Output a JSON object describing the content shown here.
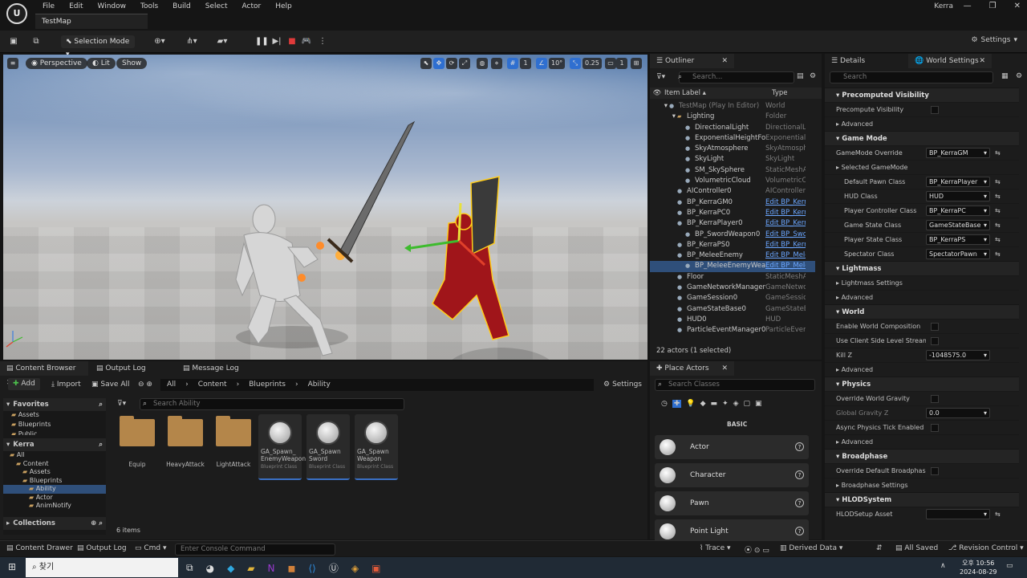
{
  "menu": [
    "File",
    "Edit",
    "Window",
    "Tools",
    "Build",
    "Select",
    "Actor",
    "Help"
  ],
  "project_name": "Kerra",
  "map_tab": "TestMap",
  "toolbar": {
    "selection_mode": "Selection Mode",
    "settings": "Settings"
  },
  "viewport": {
    "perspective": "Perspective",
    "lit": "Lit",
    "show": "Show",
    "grid_size": "1",
    "rot_snap": "10°",
    "scale_snap": "0.25",
    "cam_speed": "1"
  },
  "outliner": {
    "tab": "Outliner",
    "search_placeholder": "Search...",
    "col_label": "Item Label ▴",
    "col_type": "Type",
    "rows": [
      {
        "label": "TestMap (Play In Editor)",
        "type": "World",
        "indent": 0,
        "dim": true
      },
      {
        "label": "Lighting",
        "type": "Folder",
        "indent": 1
      },
      {
        "label": "DirectionalLight",
        "type": "DirectionalLi",
        "indent": 2
      },
      {
        "label": "ExponentialHeightFog",
        "type": "ExponentialH",
        "indent": 2
      },
      {
        "label": "SkyAtmosphere",
        "type": "SkyAtmosph",
        "indent": 2
      },
      {
        "label": "SkyLight",
        "type": "SkyLight",
        "indent": 2
      },
      {
        "label": "SM_SkySphere",
        "type": "StaticMeshA",
        "indent": 2
      },
      {
        "label": "VolumetricCloud",
        "type": "VolumetricClo",
        "indent": 2
      },
      {
        "label": "AIController0",
        "type": "AIController",
        "indent": 1
      },
      {
        "label": "BP_KerraGM0",
        "type": "Edit BP_Kerr",
        "indent": 1,
        "link": true
      },
      {
        "label": "BP_KerraPC0",
        "type": "Edit BP_Kerr",
        "indent": 1,
        "link": true
      },
      {
        "label": "BP_KerraPlayer0",
        "type": "Edit BP_Kerr",
        "indent": 1,
        "link": true
      },
      {
        "label": "BP_SwordWeapon0",
        "type": "Edit BP_Swo",
        "indent": 2,
        "link": true
      },
      {
        "label": "BP_KerraPS0",
        "type": "Edit BP_Kerr",
        "indent": 1,
        "link": true
      },
      {
        "label": "BP_MeleeEnemy",
        "type": "Edit BP_Mele",
        "indent": 1,
        "link": true
      },
      {
        "label": "BP_MeleeEnemyWeapo",
        "type": "Edit BP_Mele",
        "indent": 2,
        "link": true,
        "selected": true
      },
      {
        "label": "Floor",
        "type": "StaticMeshA",
        "indent": 1
      },
      {
        "label": "GameNetworkManager0",
        "type": "GameNetwor",
        "indent": 1
      },
      {
        "label": "GameSession0",
        "type": "GameSessio",
        "indent": 1
      },
      {
        "label": "GameStateBase0",
        "type": "GameStateB",
        "indent": 1
      },
      {
        "label": "HUD0",
        "type": "HUD",
        "indent": 1
      },
      {
        "label": "ParticleEventManager0",
        "type": "ParticleEven",
        "indent": 1
      }
    ],
    "status": "22 actors (1 selected)"
  },
  "details": {
    "tab1": "Details",
    "tab2": "World Settings",
    "search": "Search",
    "sections": [
      {
        "kind": "hdr",
        "text": "Precomputed Visibility"
      },
      {
        "kind": "cb",
        "text": "Precompute Visibility"
      },
      {
        "kind": "sub",
        "text": "Advanced"
      },
      {
        "kind": "hdr",
        "text": "Game Mode"
      },
      {
        "kind": "dd",
        "text": "GameMode Override",
        "value": "BP_KerraGM"
      },
      {
        "kind": "sub",
        "text": "Selected GameMode"
      },
      {
        "kind": "dd2",
        "text": "Default Pawn Class",
        "value": "BP_KerraPlayer"
      },
      {
        "kind": "dd2",
        "text": "HUD Class",
        "value": "HUD"
      },
      {
        "kind": "dd2",
        "text": "Player Controller Class",
        "value": "BP_KerraPC"
      },
      {
        "kind": "dd2",
        "text": "Game State Class",
        "value": "GameStateBase"
      },
      {
        "kind": "dd2",
        "text": "Player State Class",
        "value": "BP_KerraPS"
      },
      {
        "kind": "dd2",
        "text": "Spectator Class",
        "value": "SpectatorPawn"
      },
      {
        "kind": "hdr",
        "text": "Lightmass"
      },
      {
        "kind": "sub",
        "text": "Lightmass Settings"
      },
      {
        "kind": "sub",
        "text": "Advanced"
      },
      {
        "kind": "hdr",
        "text": "World"
      },
      {
        "kind": "cb",
        "text": "Enable World Composition"
      },
      {
        "kind": "cb",
        "text": "Use Client Side Level Stream..."
      },
      {
        "kind": "num",
        "text": "Kill Z",
        "value": "-1048575.0"
      },
      {
        "kind": "sub",
        "text": "Advanced"
      },
      {
        "kind": "hdr",
        "text": "Physics"
      },
      {
        "kind": "cb",
        "text": "Override World Gravity"
      },
      {
        "kind": "num",
        "text": "Global Gravity Z",
        "value": "0.0",
        "dim": true
      },
      {
        "kind": "cb",
        "text": "Async Physics Tick Enabled"
      },
      {
        "kind": "sub",
        "text": "Advanced"
      },
      {
        "kind": "hdr",
        "text": "Broadphase"
      },
      {
        "kind": "cb",
        "text": "Override Default Broadphase..."
      },
      {
        "kind": "sub",
        "text": "Broadphase Settings"
      },
      {
        "kind": "hdr",
        "text": "HLODSystem"
      },
      {
        "kind": "dd",
        "text": "HLODSetup Asset",
        "value": ""
      }
    ]
  },
  "content": {
    "tab1": "Content Browser",
    "tab2": "Output Log",
    "tab3": "Message Log",
    "add": "Add",
    "import": "Import",
    "save_all": "Save All",
    "path": [
      "All",
      "Content",
      "Blueprints",
      "Ability"
    ],
    "settings": "Settings",
    "search_placeholder": "Search Ability",
    "favorites": "Favorites",
    "fav_items": [
      "Assets",
      "Blueprints",
      "Public"
    ],
    "project": "Kerra",
    "tree": [
      "All",
      "Content",
      "Assets",
      "Blueprints",
      "Ability",
      "Actor",
      "AnimNotify"
    ],
    "collections": "Collections",
    "folders": [
      "Equip",
      "HeavyAttack",
      "LightAttack"
    ],
    "assets": [
      {
        "name": "GA_Spawn_ EnemyWeapon",
        "cls": "Blueprint Class"
      },
      {
        "name": "GA_Spawn Sword",
        "cls": "Blueprint Class"
      },
      {
        "name": "GA_Spawn Weapon",
        "cls": "Blueprint Class"
      }
    ],
    "count": "6 items"
  },
  "place": {
    "tab": "Place Actors",
    "search": "Search Classes",
    "basic": "BASIC",
    "actors": [
      "Actor",
      "Character",
      "Pawn",
      "Point Light"
    ]
  },
  "status": {
    "drawer": "Content Drawer",
    "output": "Output Log",
    "cmd": "Cmd",
    "console": "Enter Console Command",
    "trace": "Trace",
    "derived": "Derived Data",
    "saved": "All Saved",
    "revision": "Revision Control"
  },
  "taskbar": {
    "search": "찾기",
    "time": "오후 10:56",
    "date": "2024-08-29"
  }
}
